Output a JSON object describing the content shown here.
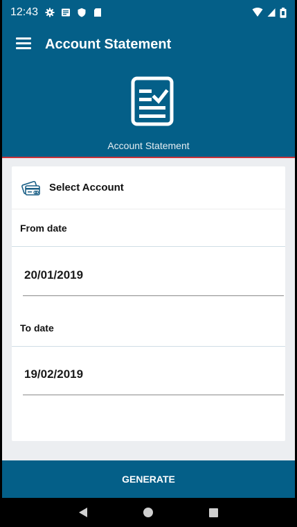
{
  "status_bar": {
    "time": "12:43",
    "icons": [
      "gear-icon",
      "message-icon",
      "shield-icon",
      "sd-card-icon"
    ],
    "right_icons": [
      "wifi-icon",
      "signal-icon",
      "battery-icon"
    ]
  },
  "app_bar": {
    "title": "Account Statement",
    "menu_icon": "hamburger-menu-icon",
    "hero_icon": "statement-document-icon",
    "hero_label": "Account Statement"
  },
  "form": {
    "select_account_label": "Select Account",
    "from_date_label": "From date",
    "from_date_value": "20/01/2019",
    "to_date_label": "To date",
    "to_date_value": "19/02/2019"
  },
  "generate_label": "GENERATE",
  "nav": {
    "back_icon": "back-triangle-icon",
    "home_icon": "home-circle-icon",
    "recents_icon": "recents-square-icon"
  },
  "colors": {
    "primary": "#045f88",
    "accent_line": "#c8323a",
    "background": "#eceef1"
  }
}
